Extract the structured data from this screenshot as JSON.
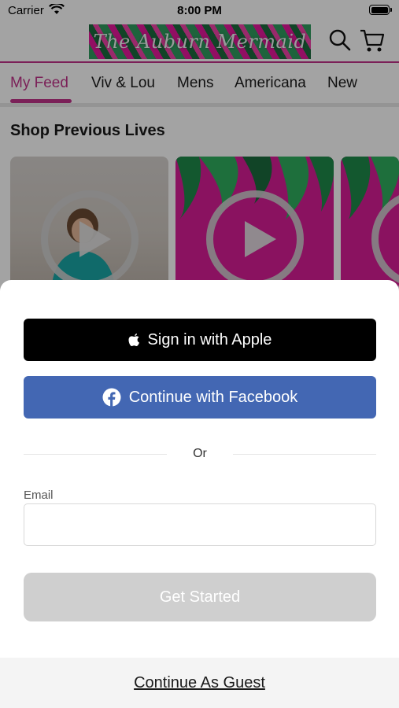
{
  "status_bar": {
    "carrier": "Carrier",
    "time": "8:00 PM"
  },
  "header": {
    "logo_text": "The Auburn Mermaid",
    "icons": [
      "search-icon",
      "cart-icon"
    ]
  },
  "tabs": [
    {
      "label": "My Feed",
      "active": true
    },
    {
      "label": "Viv & Lou",
      "active": false
    },
    {
      "label": "Mens",
      "active": false
    },
    {
      "label": "Americana",
      "active": false
    },
    {
      "label": "New",
      "active": false
    }
  ],
  "section": {
    "title": "Shop Previous Lives"
  },
  "sheet": {
    "apple_label": "Sign in with Apple",
    "facebook_label": "Continue with Facebook",
    "divider_text": "Or",
    "email_label": "Email",
    "email_value": "",
    "email_placeholder": "",
    "get_started_label": "Get Started",
    "guest_label": "Continue As Guest"
  },
  "colors": {
    "accent": "#c0338a",
    "facebook": "#4367b3",
    "apple": "#000000",
    "disabled": "#cfcfcf",
    "card_pink": "#d81d97"
  }
}
